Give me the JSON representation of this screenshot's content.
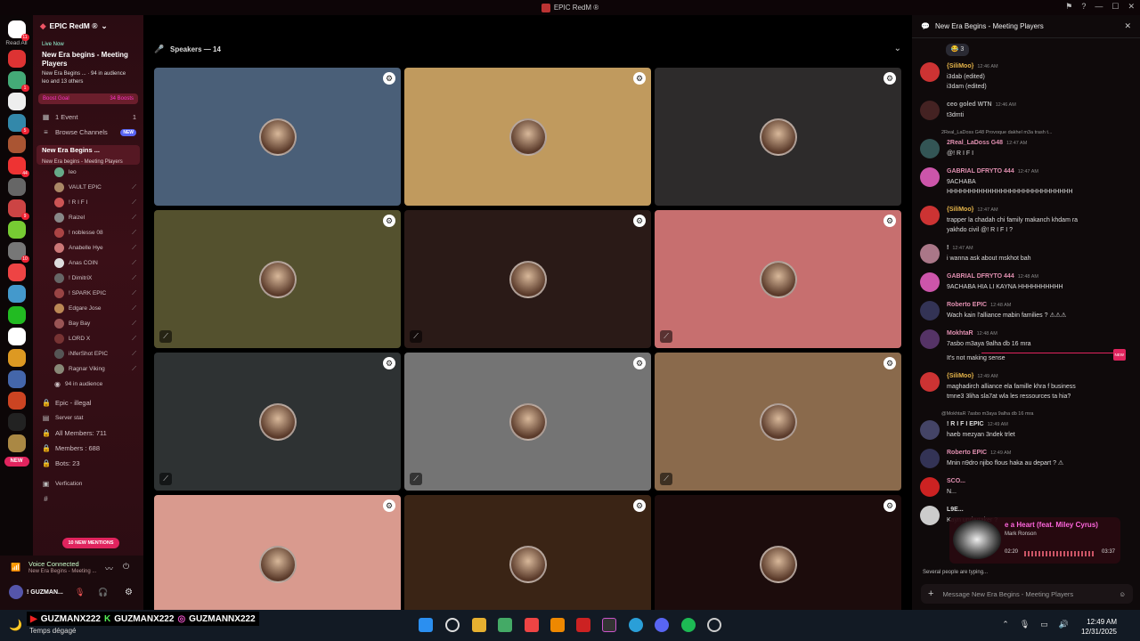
{
  "window": {
    "title": "EPIC RedM ®"
  },
  "rail": {
    "read_all": "Read All",
    "badge_top": "11",
    "badges": [
      "1",
      "5",
      "44",
      "9",
      "10"
    ],
    "new_label": "NEW"
  },
  "server": {
    "name": "EPIC RedM ®"
  },
  "live": {
    "now": "Live Now",
    "title": "New Era begins - Meeting Players",
    "sub": "New Era Begins ... · 94 in audience",
    "others": "leo and 13 others"
  },
  "boost": {
    "label": "Boost Goal",
    "count": "34 Boosts"
  },
  "channels": {
    "events": "1 Event",
    "events_count": "1",
    "browse": "Browse Channels",
    "browse_tag": "NEW",
    "stage_name": "New Era Begins ...",
    "stage_sub": "New Era begins - Meeting Players",
    "audience": "94 in audience",
    "illegal": "Epic - illegal",
    "server_stat": "Server stat",
    "all_members": "All Members: 711",
    "members": "Members : 688",
    "bots": "Bots: 23",
    "verification": "Verfication"
  },
  "voice_users": [
    {
      "name": "leo",
      "color": "#6a8"
    },
    {
      "name": "VAULT  EPIC",
      "color": "#a86"
    },
    {
      "name": "! R I F I",
      "color": "#c55"
    },
    {
      "name": "Raizel",
      "color": "#888"
    },
    {
      "name": "! noblesse  08",
      "color": "#a44"
    },
    {
      "name": "Anabelle Hye",
      "color": "#c77"
    },
    {
      "name": "Anas  COIN",
      "color": "#ddd"
    },
    {
      "name": "! DimitriX",
      "color": "#666"
    },
    {
      "name": "! SPARK  EPIC",
      "color": "#944"
    },
    {
      "name": "Edgare Jose",
      "color": "#b85"
    },
    {
      "name": "Bay Bay",
      "color": "#955"
    },
    {
      "name": "LORD X",
      "color": "#733"
    },
    {
      "name": "iNferShot  EPIC",
      "color": "#555"
    },
    {
      "name": "Ragnar Viking",
      "color": "#887"
    }
  ],
  "mentions": "10 NEW MENTIONS",
  "voicebar": {
    "status": "Voice Connected",
    "sub": "New Era Begins - Meeting ...",
    "user": "! GUZMAN..."
  },
  "stage": {
    "speakers": "Speakers — 14"
  },
  "tiles": [
    {
      "bg": "#4a5f78",
      "muted": false
    },
    {
      "bg": "#c09a5e",
      "muted": false
    },
    {
      "bg": "#2d2b2b",
      "muted": false
    },
    {
      "bg": "#54512e",
      "muted": true
    },
    {
      "bg": "#2a1a17",
      "muted": true
    },
    {
      "bg": "#c76f6f",
      "muted": true
    },
    {
      "bg": "#2e3233",
      "muted": true
    },
    {
      "bg": "#747474",
      "muted": true
    },
    {
      "bg": "#8a6a4c",
      "muted": true
    },
    {
      "bg": "#d99a8e",
      "muted": false
    },
    {
      "bg": "#3a2415",
      "muted": false
    },
    {
      "bg": "#1c0c0c",
      "muted": false
    }
  ],
  "chat": {
    "title": "New Era Begins - Meeting Players",
    "reaction": "😂 3",
    "messages": [
      {
        "name": "{SiliMoo}",
        "color": "#e6b54a",
        "time": "12:46 AM",
        "lines": [
          "i3dab (edited)",
          "i3dam (edited)"
        ],
        "av": "#c33"
      },
      {
        "name": "ceo goled  WTN",
        "color": "#aaa",
        "time": "12:46 AM",
        "lines": [
          "t3dmti"
        ],
        "av": "#422"
      },
      {
        "name": "2Real_LaDoss  G48",
        "color": "#e08fb0",
        "time": "12:47 AM",
        "lines": [
          "@! R I F I"
        ],
        "av": "#355",
        "reply": "2Real_LaDoss  G48  Provoque dakhel m3a trash t..."
      },
      {
        "name": "GABRIAL DFRYTO  444",
        "color": "#e08fb0",
        "time": "12:47 AM",
        "lines": [
          "9ACHABA",
          "HHHHHHHHHHHHHHHHHHHHHHHHHHHH"
        ],
        "av": "#c5a"
      },
      {
        "name": "{SiliMoo}",
        "color": "#e6b54a",
        "time": "12:47 AM",
        "lines": [
          "trapper la chadah chi family makanch khdam ra",
          "yakhdo civil  @! R I F I  ?"
        ],
        "av": "#c33"
      },
      {
        "name": "!",
        "color": "#ddd",
        "time": "12:47 AM",
        "lines": [
          "i wanna ask about mskhot bah"
        ],
        "av": "#a78"
      },
      {
        "name": "GABRIAL DFRYTO  444",
        "color": "#e08fb0",
        "time": "12:48 AM",
        "lines": [
          "9ACHABA HIA LI KAYNA HHHHHHHHHH"
        ],
        "av": "#c5a"
      },
      {
        "name": "Roberto  EPIC",
        "color": "#e08fb0",
        "time": "12:48 AM",
        "lines": [
          "Wach kain l'alliance mabin families ? ⚠⚠⚠"
        ],
        "av": "#335"
      },
      {
        "name": "MokhtaR",
        "color": "#e08fb0",
        "time": "12:48 AM",
        "lines": [
          "7asbo m3aya 9alha db 16 mra",
          "It's not making sense"
        ],
        "av": "#536"
      },
      {
        "name": "{SiliMoo}",
        "color": "#e6b54a",
        "time": "12:49 AM",
        "lines": [
          "maghadirch alliance ela famille khra f business",
          "tmne3 3liha sla7at wla les ressources ta hia?"
        ],
        "av": "#c33"
      },
      {
        "name": "! R I F I  EPIC",
        "color": "#ddd",
        "time": "12:49 AM",
        "lines": [
          "haeb mezyan 3ndek trlet"
        ],
        "av": "#446",
        "reply": "@MokhtaR  7asbo m3aya 9alha db 16 mra"
      },
      {
        "name": "Roberto  EPIC",
        "color": "#e08fb0",
        "time": "12:49 AM",
        "lines": [
          "Mnin n9dro njibo flous haka au depart ? ⚠"
        ],
        "av": "#335"
      },
      {
        "name": "SCO...",
        "color": "#e08fb0",
        "time": "",
        "lines": [
          "N..."
        ],
        "av": "#c22"
      },
      {
        "name": "L9E...",
        "color": "#ddd",
        "time": "",
        "lines": [
          "Kayn undertaker ?"
        ],
        "av": "#ccc"
      }
    ],
    "new_tag": "NEW",
    "typing": "Several people are typing...",
    "input_placeholder": "Message New Era Begins - Meeting Players"
  },
  "player": {
    "title": "e a Heart (feat. Miley Cyrus)",
    "artist": "Mark Ronson",
    "elapsed": "02:20",
    "total": "03:37",
    "progress": 0.64
  },
  "taskbar": {
    "weather": "Temps dégagé",
    "banner": [
      "GUZMANX222",
      "GUZMANX222",
      "GUZMANNX222"
    ],
    "time": "12:49 AM",
    "date": "12/31/2025"
  }
}
